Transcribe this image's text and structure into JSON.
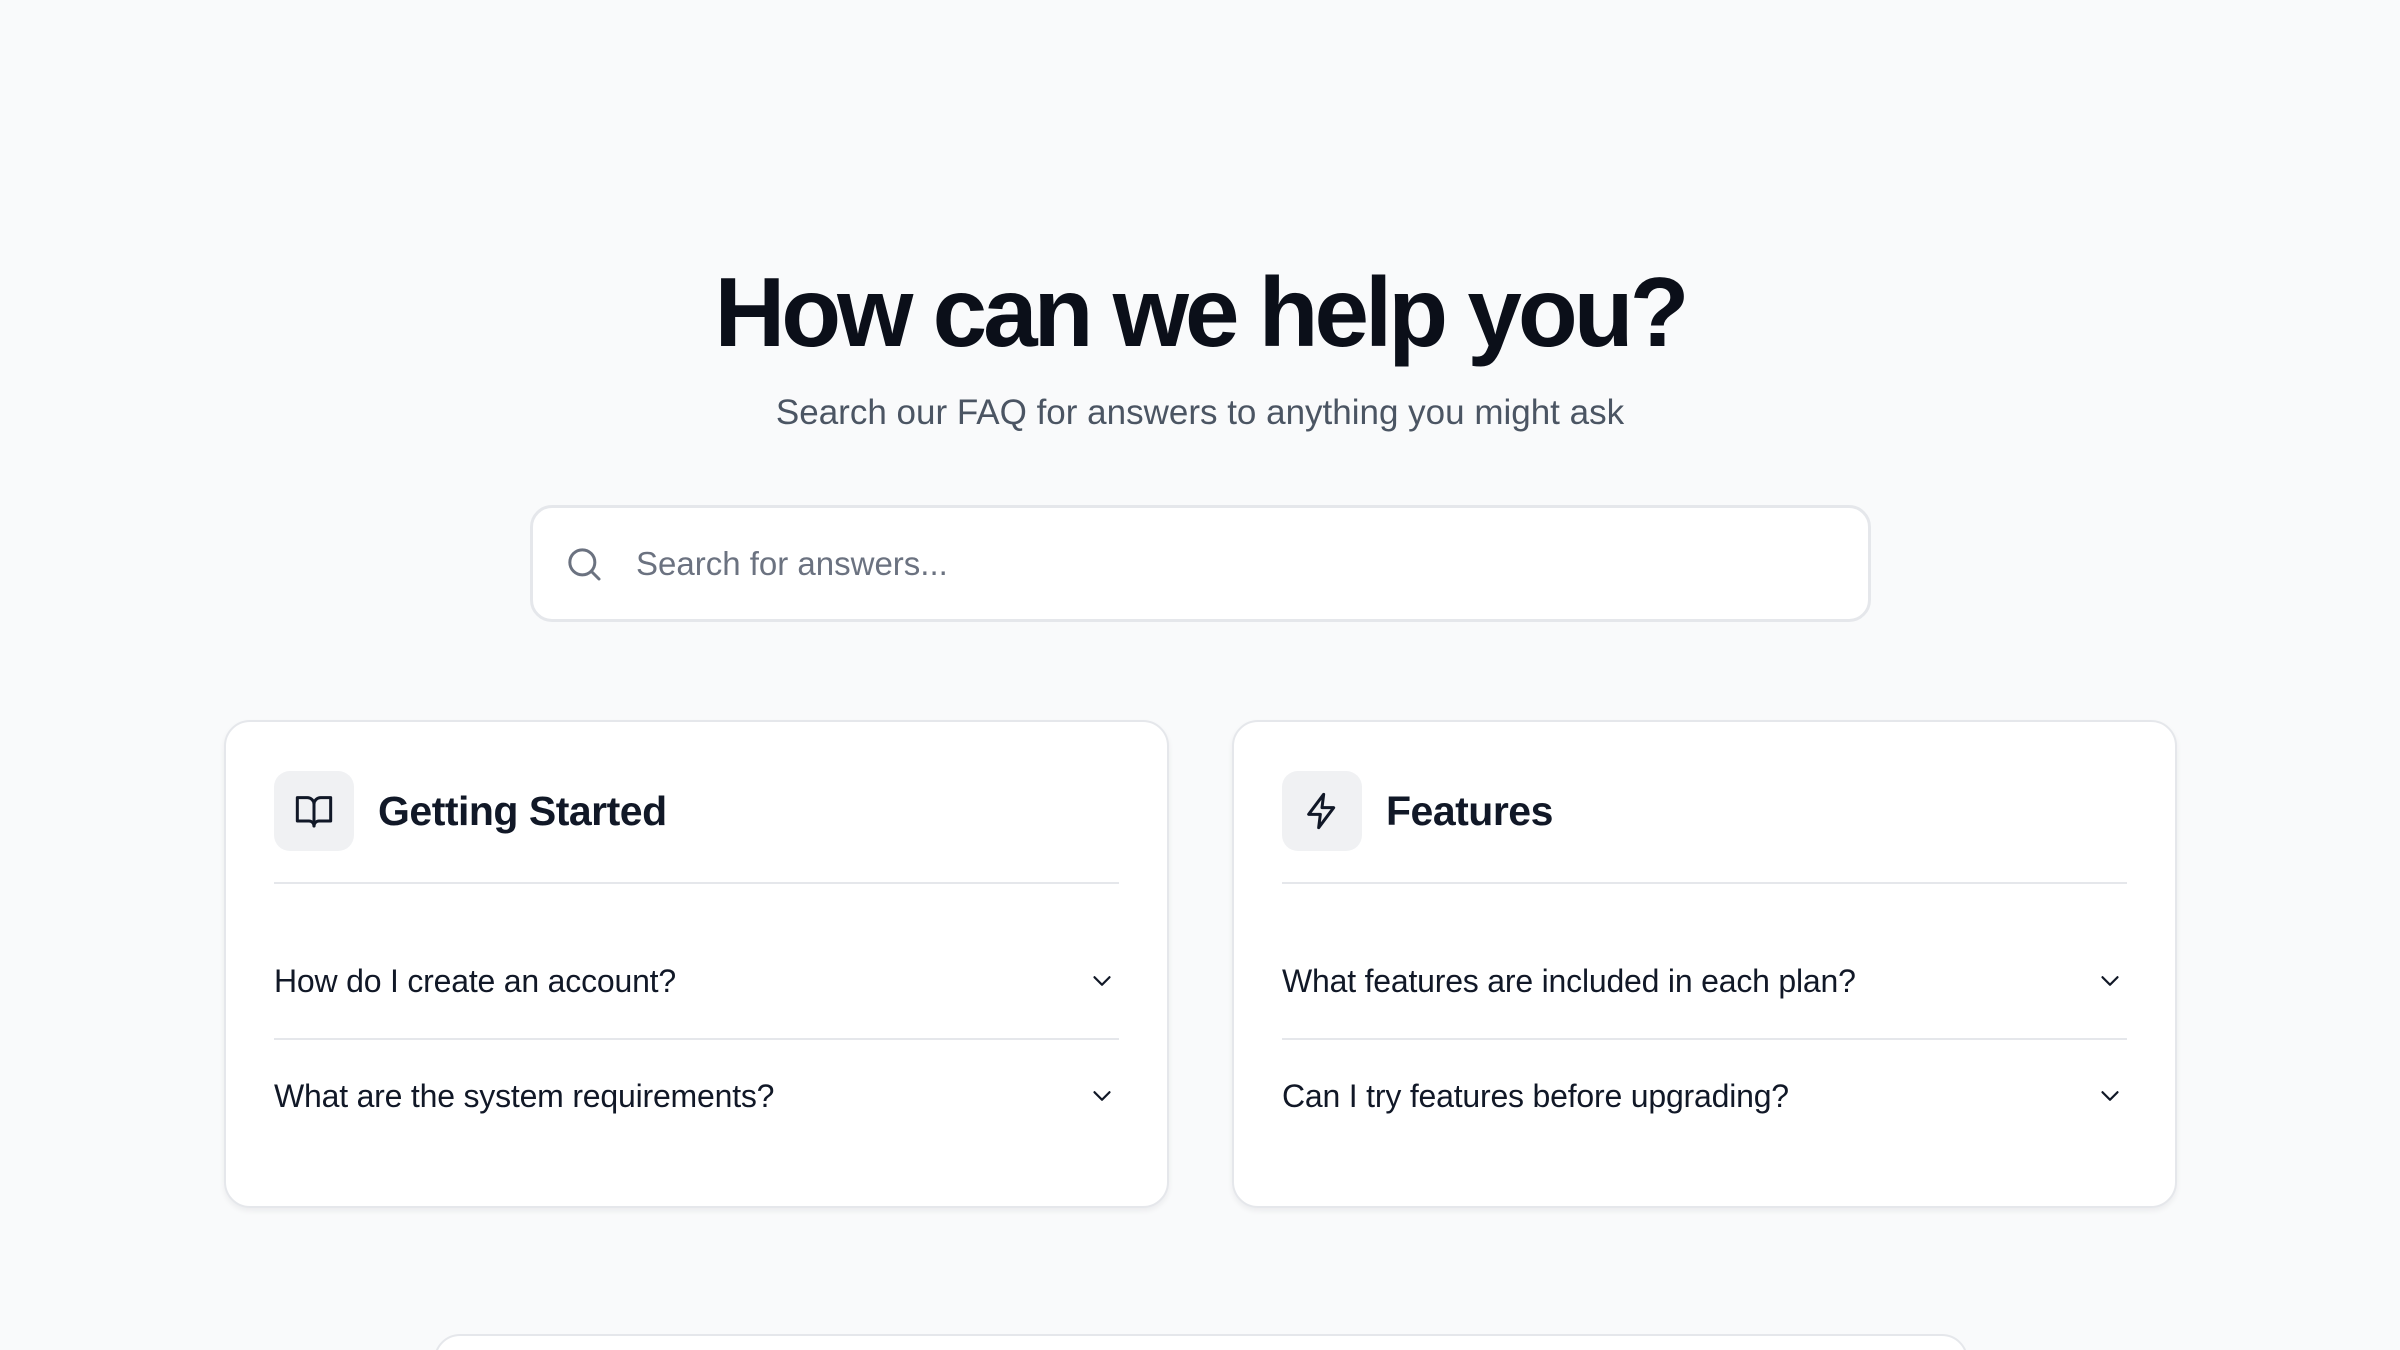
{
  "hero": {
    "title": "How can we help you?",
    "subtitle": "Search our FAQ for answers to anything you might ask"
  },
  "search": {
    "placeholder": "Search for answers...",
    "value": "",
    "icon": "search-icon"
  },
  "categories": [
    {
      "title": "Getting Started",
      "icon": "book-open-icon",
      "questions": [
        "How do I create an account?",
        "What are the system requirements?"
      ]
    },
    {
      "title": "Features",
      "icon": "lightning-bolt-icon",
      "questions": [
        "What features are included in each plan?",
        "Can I try features before upgrading?"
      ]
    }
  ],
  "colors": {
    "background": "#f9fafb",
    "card": "#ffffff",
    "border": "#e5e7eb",
    "heading": "#0b0f19",
    "muted": "#4b5563",
    "icon_tile": "#f0f1f3"
  }
}
